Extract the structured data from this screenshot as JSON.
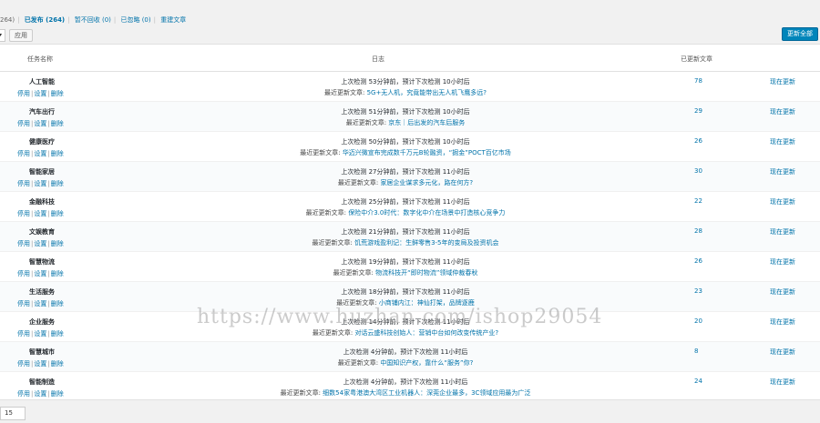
{
  "views": {
    "all_count": "264)",
    "published": "已发布 (264)",
    "trash": "暂不回收 (0)",
    "ignored": "已忽略 (0)",
    "rebuild": "重建文章"
  },
  "bulk": {
    "apply_label": "应用"
  },
  "update_all_label": "更新全部",
  "table": {
    "col_name": "任务名称",
    "col_log": "日志",
    "col_count": "已更新文章",
    "actions": {
      "stop": "停用",
      "settings": "设置",
      "delete": "删除"
    },
    "update_now": "现在更新",
    "rows": [
      {
        "title": "人工智能",
        "status": "上次检测 53分钟前，预计下次检测 10小时后",
        "label": "最近更新文章:",
        "latest": "5G+无人机，究竟能带出无人机飞鹰多远?",
        "count": "78"
      },
      {
        "title": "汽车出行",
        "status": "上次检测 51分钟前，预计下次检测 10小时后",
        "label": "最近更新文章:",
        "latest": "京东｜后出发的汽车后服务",
        "count": "29"
      },
      {
        "title": "健康医疗",
        "status": "上次检测 50分钟前，预计下次检测 10小时后",
        "label": "最近更新文章:",
        "latest": "华迈兴微宣布完成数千万元B轮融资，“掘金”POCT百亿市场",
        "count": "26"
      },
      {
        "title": "智能家居",
        "status": "上次检测 27分钟前，预计下次检测 11小时后",
        "label": "最近更新文章:",
        "latest": "家居企业谋求多元化，路在何方?",
        "count": "30"
      },
      {
        "title": "金融科技",
        "status": "上次检测 25分钟前，预计下次检测 11小时后",
        "label": "最近更新文章:",
        "latest": "保险中介3.0时代：数字化中介在场景中打造核心竞争力",
        "count": "22"
      },
      {
        "title": "文娱教育",
        "status": "上次检测 21分钟前，预计下次检测 11小时后",
        "label": "最近更新文章:",
        "latest": "饥荒游戏盈利记：生鲜零售3-5年的变局及投资机会",
        "count": "28"
      },
      {
        "title": "智慧物流",
        "status": "上次检测 19分钟前，预计下次检测 11小时后",
        "label": "最近更新文章:",
        "latest": "物流科技开“即时物流”领域仲裁春秋",
        "count": "26"
      },
      {
        "title": "生活服务",
        "status": "上次检测 18分钟前，预计下次检测 11小时后",
        "label": "最近更新文章:",
        "latest": "小商铺内江：神仙打架，品牌逐鹿",
        "count": "23"
      },
      {
        "title": "企业服务",
        "status": "上次检测 14分钟前，预计下次检测 11小时后",
        "label": "最近更新文章:",
        "latest": "对话云盛科技创始人：营销中台如何改变传统产业?",
        "count": "20"
      },
      {
        "title": "智慧城市",
        "status": "上次检测 4分钟前，预计下次检测 11小时后",
        "label": "最近更新文章:",
        "latest": "中国知识产权，靠什么“服务”你?",
        "count": "8"
      },
      {
        "title": "智能制造",
        "status": "上次检测 4分钟前，预计下次检测 11小时后",
        "label": "最近更新文章:",
        "latest": "细数54家粤港澳大湾区工业机器人：深莞企业最多，3C领域应用最为广泛",
        "count": "24"
      }
    ]
  },
  "per_page": "15",
  "watermark": "https://www.huzhan.com/ishop29054"
}
